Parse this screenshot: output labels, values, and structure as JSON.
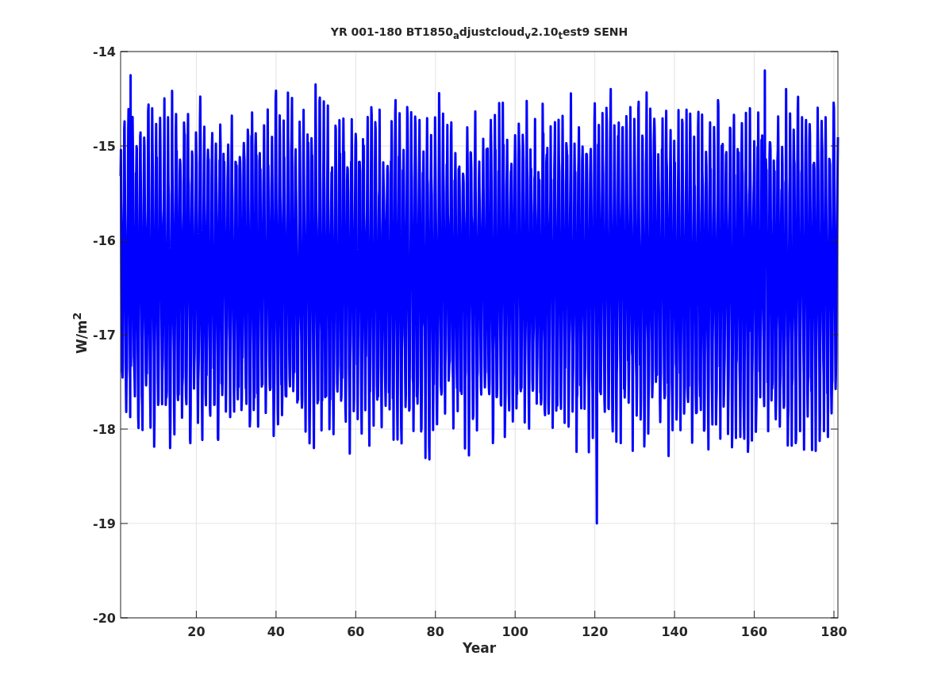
{
  "figure": {
    "title": "YR 001-180 BT1850$_{a}$djustcloud$_{v}$2.10$_{t}$est9 SENH",
    "xlabel": "Year",
    "ylabel": "W/m$^{2}$",
    "xticks": [
      "20",
      "40",
      "60",
      "80",
      "100",
      "120",
      "140",
      "160",
      "180"
    ],
    "yticks": [
      "-14",
      "-15",
      "-16",
      "-17",
      "-18",
      "-19",
      "-20"
    ]
  }
}
